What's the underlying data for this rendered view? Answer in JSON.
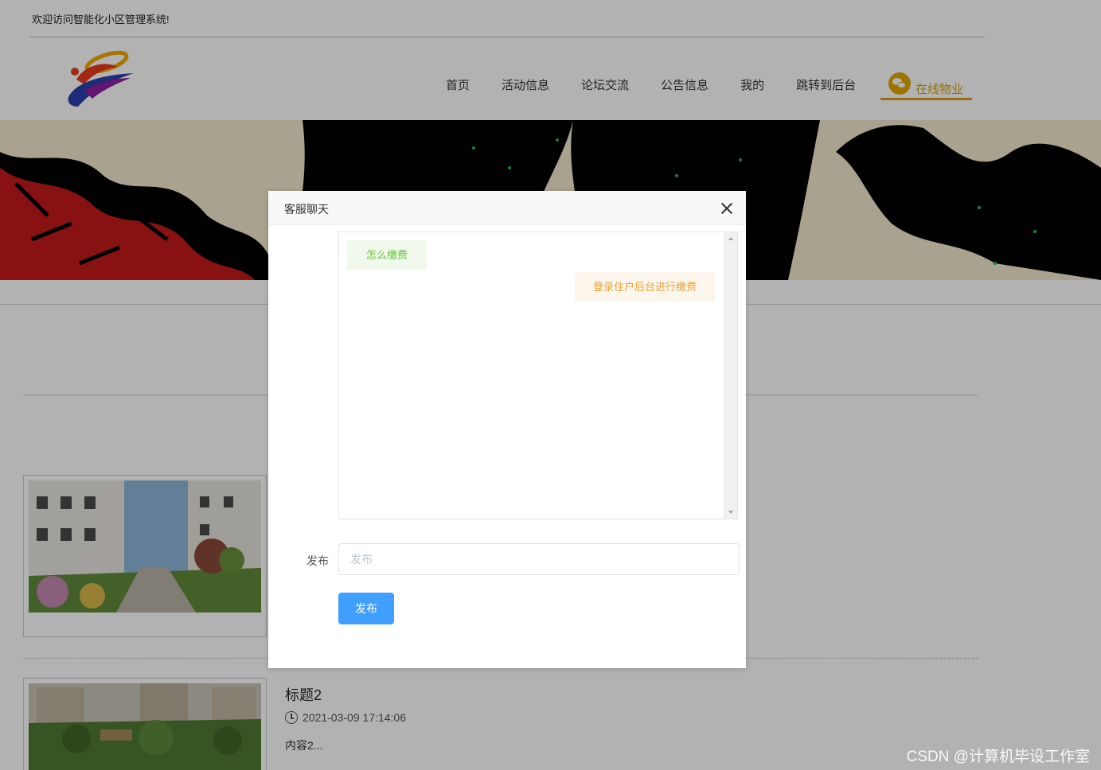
{
  "site": {
    "welcome": "欢迎访问智能化小区管理系统!"
  },
  "nav": {
    "items": [
      {
        "label": "首页"
      },
      {
        "label": "活动信息"
      },
      {
        "label": "论坛交流"
      },
      {
        "label": "公告信息"
      },
      {
        "label": "我的"
      },
      {
        "label": "跳转到后台"
      }
    ],
    "service_label": "在线物业",
    "service_icon": "wechat-icon"
  },
  "news": {
    "item2": {
      "title": "标题2",
      "time": "2021-03-09 17:14:06",
      "summary": "内容2..."
    }
  },
  "chat": {
    "title": "客服聊天",
    "messages": [
      {
        "from": "user",
        "text": "怎么缴费"
      },
      {
        "from": "admin",
        "text": "登录住户后台进行缴费"
      }
    ],
    "publish_label": "发布",
    "publish_placeholder": "发布",
    "publish_button": "发布"
  },
  "watermark": "CSDN @计算机毕设工作室",
  "colors": {
    "accent_gold": "#d4a017",
    "primary_button": "#409eff",
    "user_bubble_bg": "#f0f9eb",
    "user_bubble_text": "#67c23a",
    "admin_bubble_bg": "#fdf6ec",
    "admin_bubble_text": "#e6a23c"
  }
}
